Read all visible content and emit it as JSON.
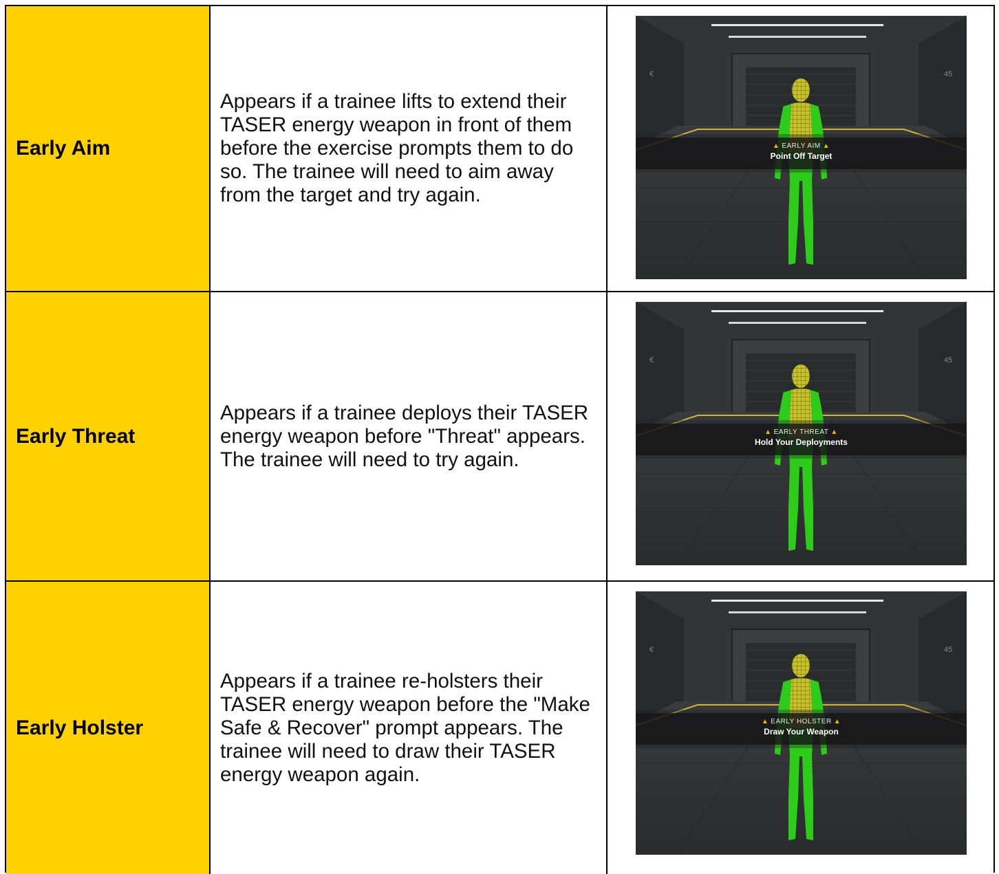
{
  "rows": [
    {
      "label": "Early Aim",
      "description": "Appears if a trainee lifts to extend their TASER energy weapon in front of them before the exercise prompts them to do so. The trainee will need to aim away from the target and try again.",
      "banner_title": "EARLY AIM",
      "banner_subtitle": "Point Off Target"
    },
    {
      "label": "Early Threat",
      "description": "Appears if a trainee deploys their TASER energy weapon before \"Threat\" appears. The trainee will need to try again.",
      "banner_title": "EARLY THREAT",
      "banner_subtitle": "Hold Your Deployments"
    },
    {
      "label": "Early Holster",
      "description": "Appears if a trainee re-holsters their TASER energy weapon before the \"Make Safe & Recover\" prompt appears. The trainee will need to draw their TASER energy weapon again.",
      "banner_title": "EARLY HOLSTER",
      "banner_subtitle": "Draw Your Weapon"
    }
  ],
  "scene": {
    "wall_marking_left": "€",
    "wall_marking_right": "45",
    "warning_icon": "warning-triangle-icon",
    "label_color": "#FFD100",
    "target_color": "#2ecc1a"
  }
}
